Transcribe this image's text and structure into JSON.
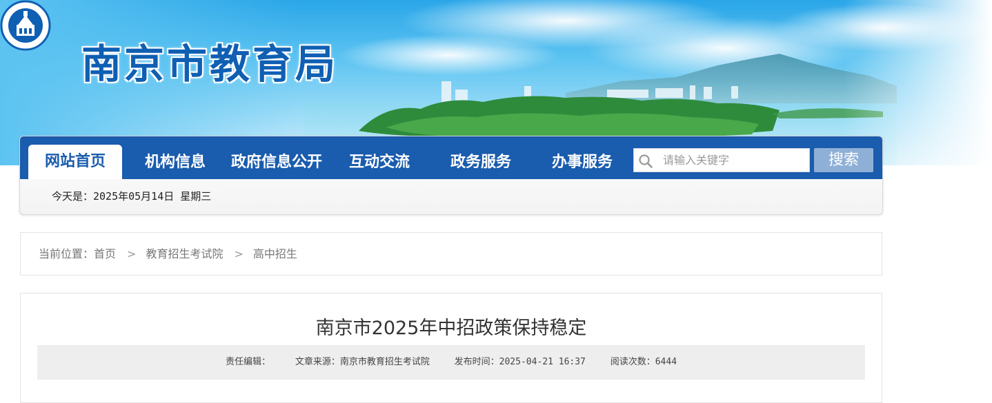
{
  "header": {
    "site_title": "南京市教育局",
    "logo_icon": "nanjing-education-seal-icon"
  },
  "nav": {
    "items": [
      {
        "label": "网站首页",
        "active": true
      },
      {
        "label": "机构信息"
      },
      {
        "label": "政府信息公开"
      },
      {
        "label": "互动交流"
      },
      {
        "label": "政务服务"
      },
      {
        "label": "办事服务"
      }
    ],
    "search_placeholder": "请输入关键字",
    "search_button": "搜索"
  },
  "date_line": "今天是：2025年05月14日 星期三",
  "breadcrumb": {
    "prefix": "当前位置：",
    "items": [
      "首页",
      "教育招生考试院",
      "高中招生"
    ],
    "separator": ">"
  },
  "article": {
    "title": "南京市2025年中招政策保持稳定",
    "meta": {
      "editor": "责任编辑：",
      "source": "文章来源：南京市教育招生考试院",
      "published": "发布时间：2025-04-21 16:37",
      "views": "阅读次数：6444"
    }
  },
  "colors": {
    "nav_blue": "#1a5cad",
    "search_button": "#8fb0d6",
    "title_blue": "#0f5fb3"
  }
}
